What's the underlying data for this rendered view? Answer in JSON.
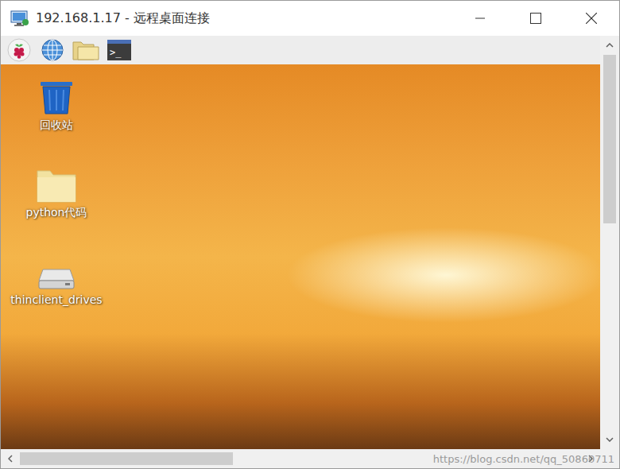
{
  "window": {
    "title": "192.168.1.17 - 远程桌面连接"
  },
  "taskbar": {
    "items": [
      {
        "kind": "menu",
        "label": ""
      },
      {
        "kind": "browser",
        "label": ""
      },
      {
        "kind": "files",
        "label": ""
      },
      {
        "kind": "terminal",
        "label": ">_"
      }
    ]
  },
  "desktop": {
    "icons": [
      {
        "label": "回收站",
        "kind": "trash",
        "selected": false
      },
      {
        "label": "python代码",
        "kind": "folder",
        "selected": false
      },
      {
        "label": "thinclient_drives",
        "kind": "drive",
        "selected": false
      }
    ]
  },
  "scrollbars": {
    "vertical": {
      "position": 0,
      "level": 0.45
    },
    "horizontal": {
      "position": 0,
      "level": 0.38
    }
  },
  "watermark": "https://blog.csdn.net/qq_50860711"
}
